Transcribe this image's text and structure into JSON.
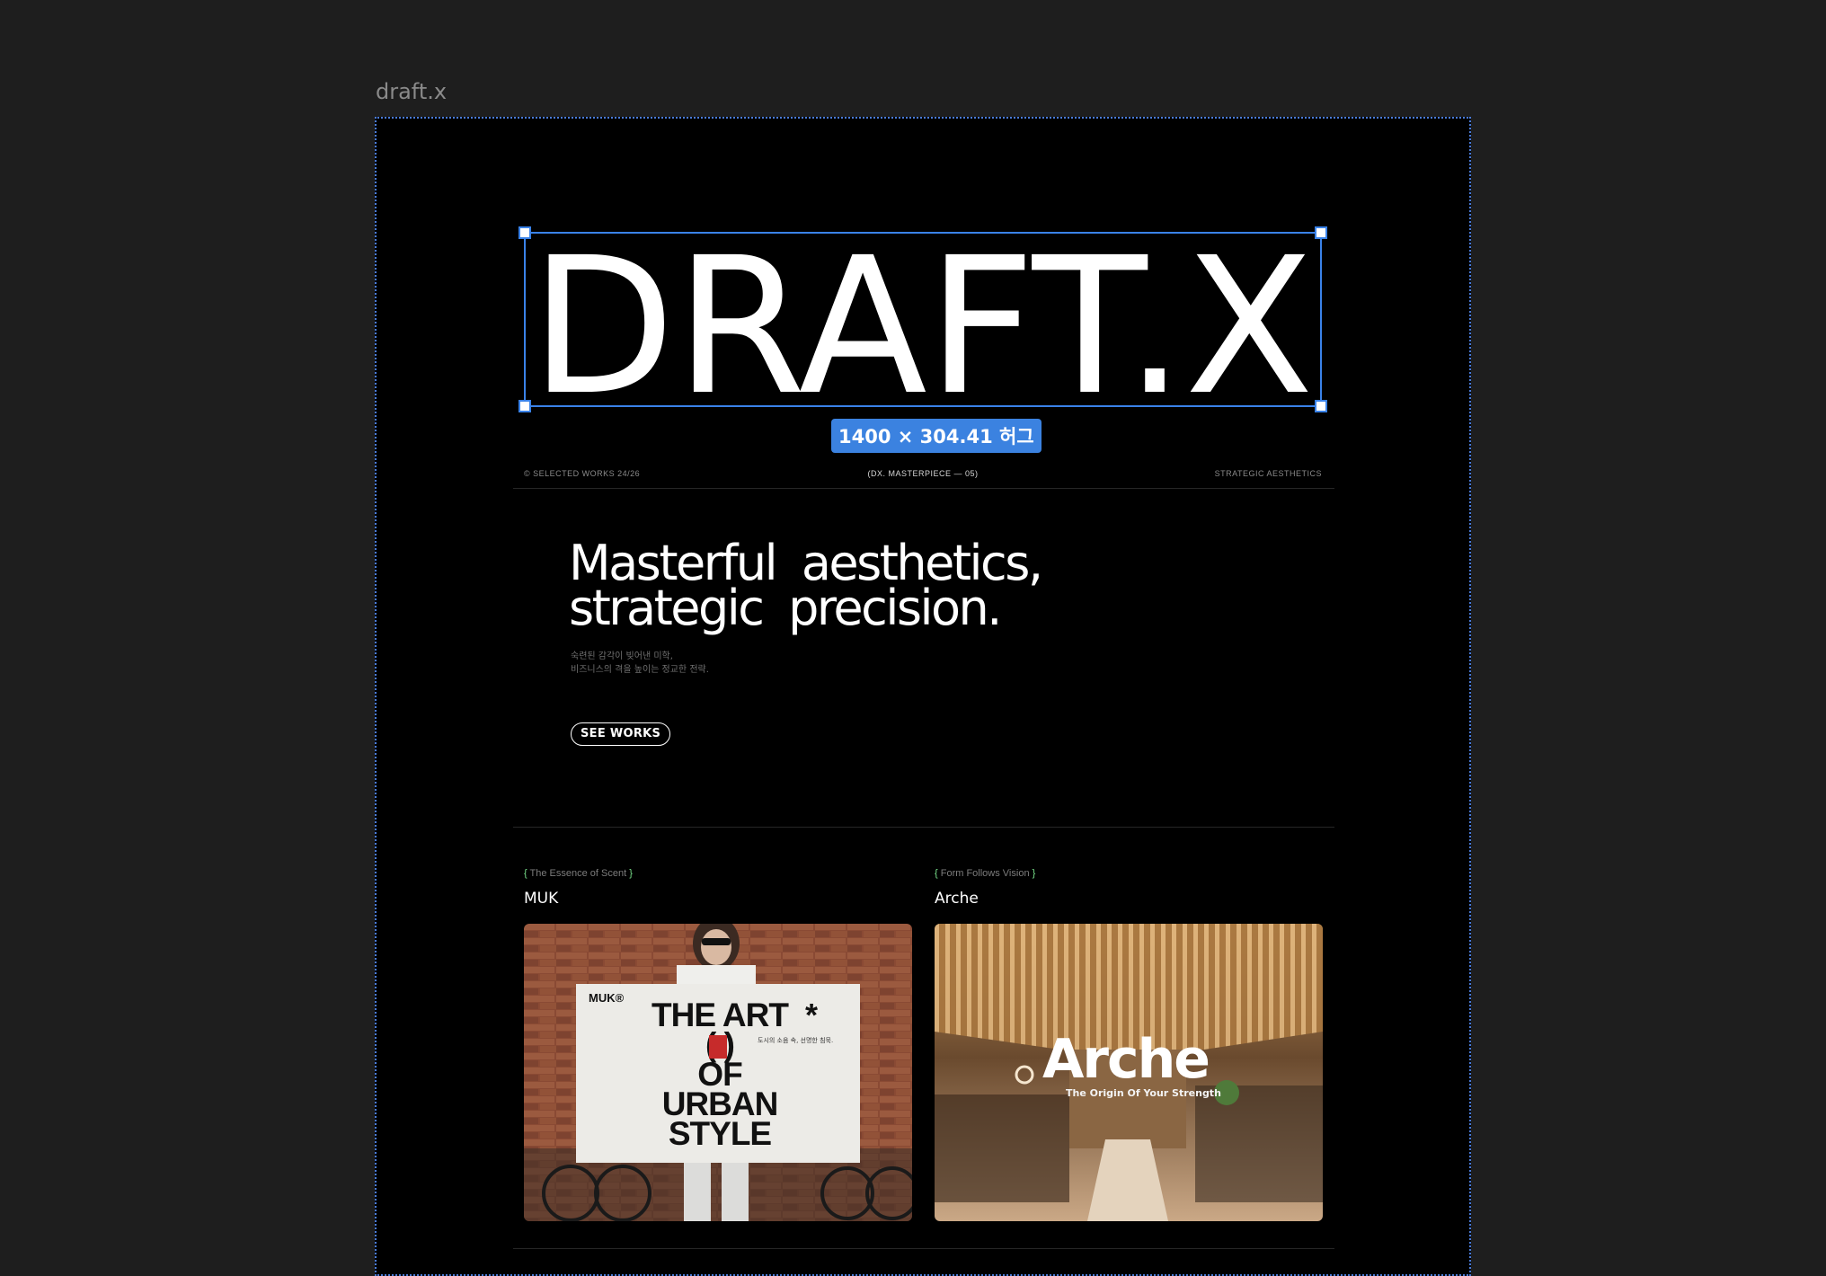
{
  "frame": {
    "label": "draft.x"
  },
  "hero": {
    "logo_text": "DRAFT.X",
    "dimension_badge": "1400 × 304.41 허그"
  },
  "meta": {
    "left": "© SELECTED WORKS 24/26",
    "center": "(DX. MASTERPIECE — 05)",
    "right": "STRATEGIC AESTHETICS"
  },
  "intro": {
    "headline_line1": "Masterful aesthetics,",
    "headline_line2": "strategic precision.",
    "sub_line1": "숙련된 감각이 빚어낸 미학,",
    "sub_line2": "비즈니스의 격을 높이는 정교한 전략.",
    "cta_label": "SEE WORKS"
  },
  "works": [
    {
      "tag": "The Essence of Scent",
      "title": "MUK",
      "poster": {
        "brand": "MUK®",
        "line1": "THE ART",
        "line2": "( )",
        "line3": "OF",
        "line4": "URBAN",
        "line5": "STYLE",
        "asterisk": "*",
        "korean": "도시의 소음 속, 선명한 침묵."
      }
    },
    {
      "tag": "Form Follows Vision",
      "title": "Arche",
      "poster": {
        "wordmark": "Arche",
        "tagline": "The Origin Of Your Strength"
      }
    }
  ],
  "colors": {
    "canvas": "#1e1e1e",
    "frame_bg": "#000000",
    "selection": "#3a82e8",
    "bracket": "#78e08a"
  }
}
